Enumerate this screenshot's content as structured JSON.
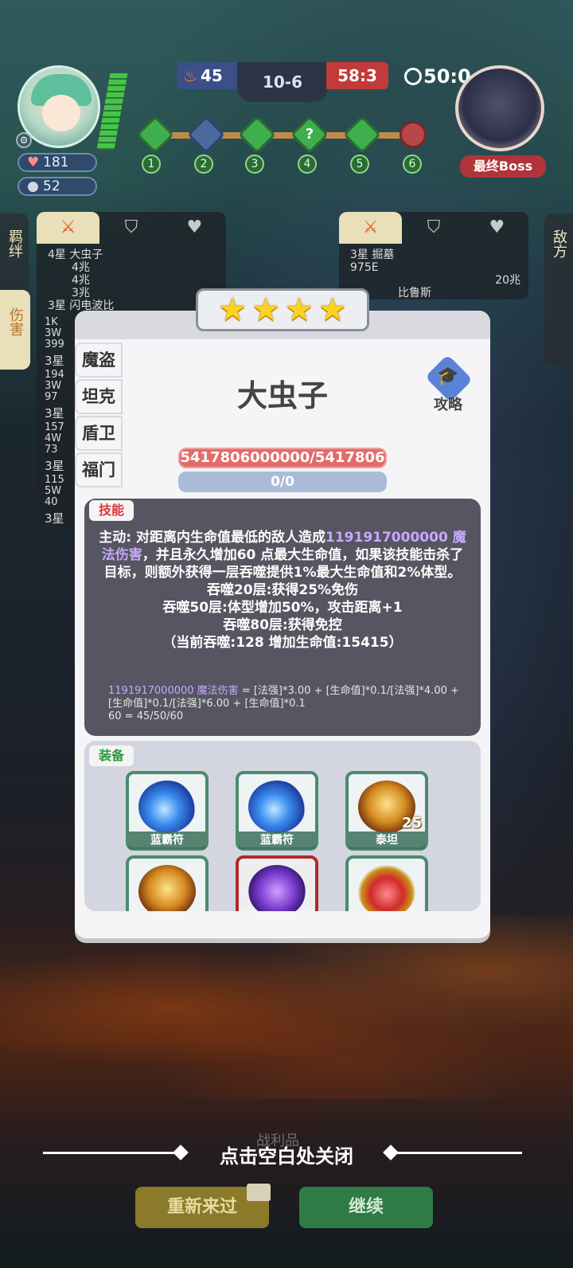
{
  "hud": {
    "player_hp": "181",
    "player_coins": "52",
    "left_score": "45",
    "round": "10-6",
    "right_score": "58:3",
    "timer": "50:0",
    "boss_label": "最终Boss",
    "stages": [
      "1",
      "2",
      "3",
      "4",
      "5",
      "6"
    ],
    "mystery_mark": "?"
  },
  "side": {
    "left_tab_top": "羁绊",
    "left_tab_selected": "伤害",
    "right_tab": "敌方",
    "left_rows": [
      "4星 大虫子",
      "4兆",
      "4兆",
      "3兆",
      "3星 闪电波比"
    ],
    "left_numbers": [
      "1K",
      "3W",
      "399",
      "3星",
      "194",
      "3W",
      "97",
      "3星",
      "157",
      "4W",
      "73",
      "3星",
      "115",
      "5W",
      "40",
      "3星"
    ],
    "right_rows": [
      "3星 掘墓",
      "975E",
      "20兆",
      "比鲁斯"
    ]
  },
  "modal": {
    "stars": [
      "★",
      "★",
      "★",
      "★"
    ],
    "name": "大虫子",
    "guide_label": "攻略",
    "roles": [
      "魔盗",
      "坦克",
      "盾卫",
      "福门"
    ],
    "hp": "5417806000000/5417806",
    "mp": "0/0",
    "skill_tag": "技能",
    "skill_line1_pre": "主动: 对距离内生命值最低的敌人造成",
    "skill_line1_hl": "1191917000000 魔法伤害",
    "skill_rest": "，并且永久增加60 点最大生命值，如果该技能击杀了目标，则额外获得一层吞噬提供1%最大生命值和2%体型。",
    "skill_l2": "吞噬20层:获得25%免伤",
    "skill_l3": "吞噬50层:体型增加50%，攻击距离+1",
    "skill_l4": "吞噬80层:获得免控",
    "skill_l5": "（当前吞噬:128 增加生命值:15415）",
    "formula_hl": "1191917000000 魔法伤害",
    "formula_rest": "= [法强]*3.00 + [生命值]*0.1/[法强]*4.00 + [生命值]*0.1/[法强]*6.00 + [生命值]*0.1",
    "formula_l2": "60 = 45/50/60",
    "equip_tag": "装备",
    "items": [
      {
        "name": "蓝霸符",
        "level": ""
      },
      {
        "name": "蓝霸符",
        "level": ""
      },
      {
        "name": "泰坦",
        "level": "25"
      },
      {
        "name": "",
        "level": ""
      },
      {
        "name": "",
        "level": ""
      },
      {
        "name": "",
        "level": ""
      }
    ]
  },
  "bottom": {
    "close_hint": "点击空白处关闭",
    "ghost": "战利品",
    "retry": "重新来过",
    "continue": "继续"
  }
}
